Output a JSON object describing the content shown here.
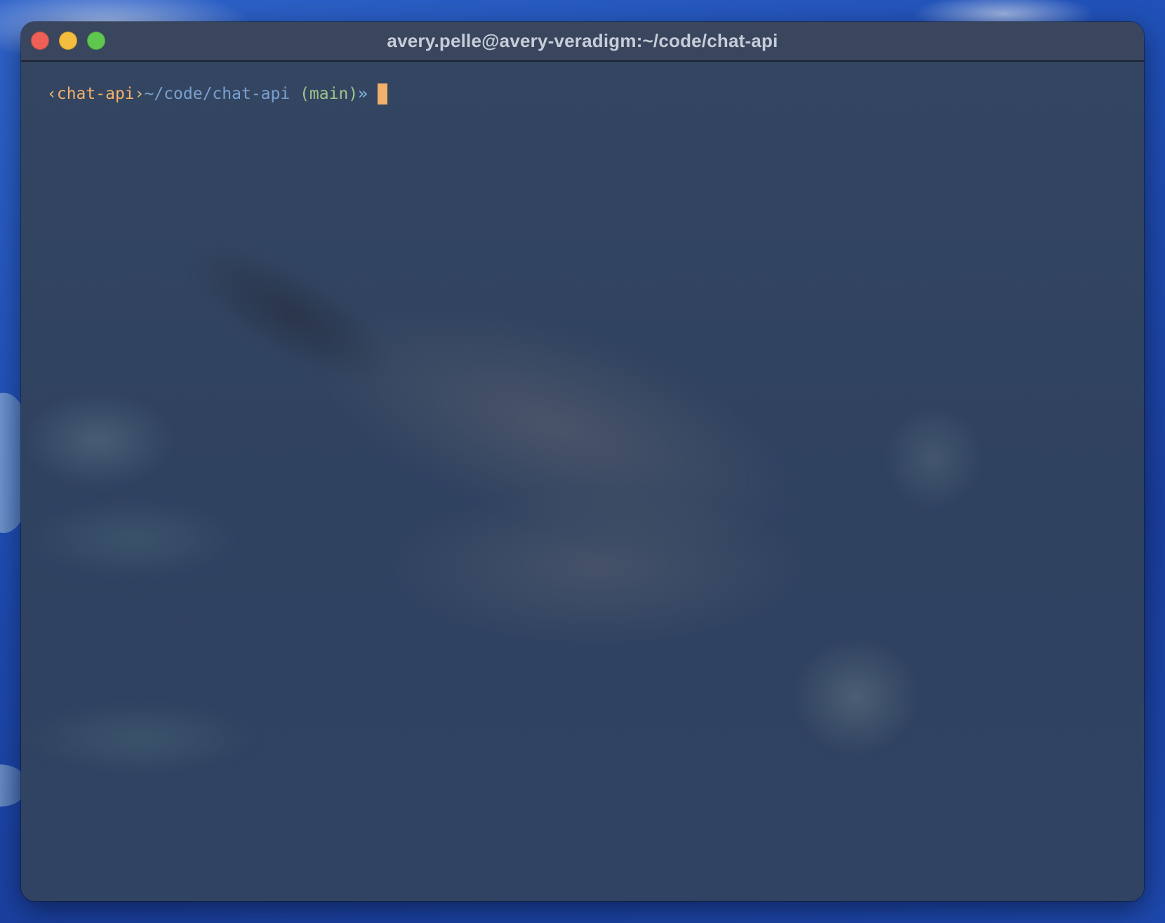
{
  "window": {
    "title": "avery.pelle@avery-veradigm:~/code/chat-api"
  },
  "prompt": {
    "open_bracket": "‹",
    "project": "chat-api",
    "close_bracket": "›",
    "path": "~/code/chat-api",
    "branch": " (main)",
    "arrow": "»"
  },
  "colors": {
    "close": "#ed5f57",
    "minimize": "#f5bd3d",
    "zoom": "#5fc74f",
    "cursor": "#f3b06c",
    "project": "#f2b06b",
    "path": "#7aa0cf",
    "branch": "#9ec58a"
  }
}
